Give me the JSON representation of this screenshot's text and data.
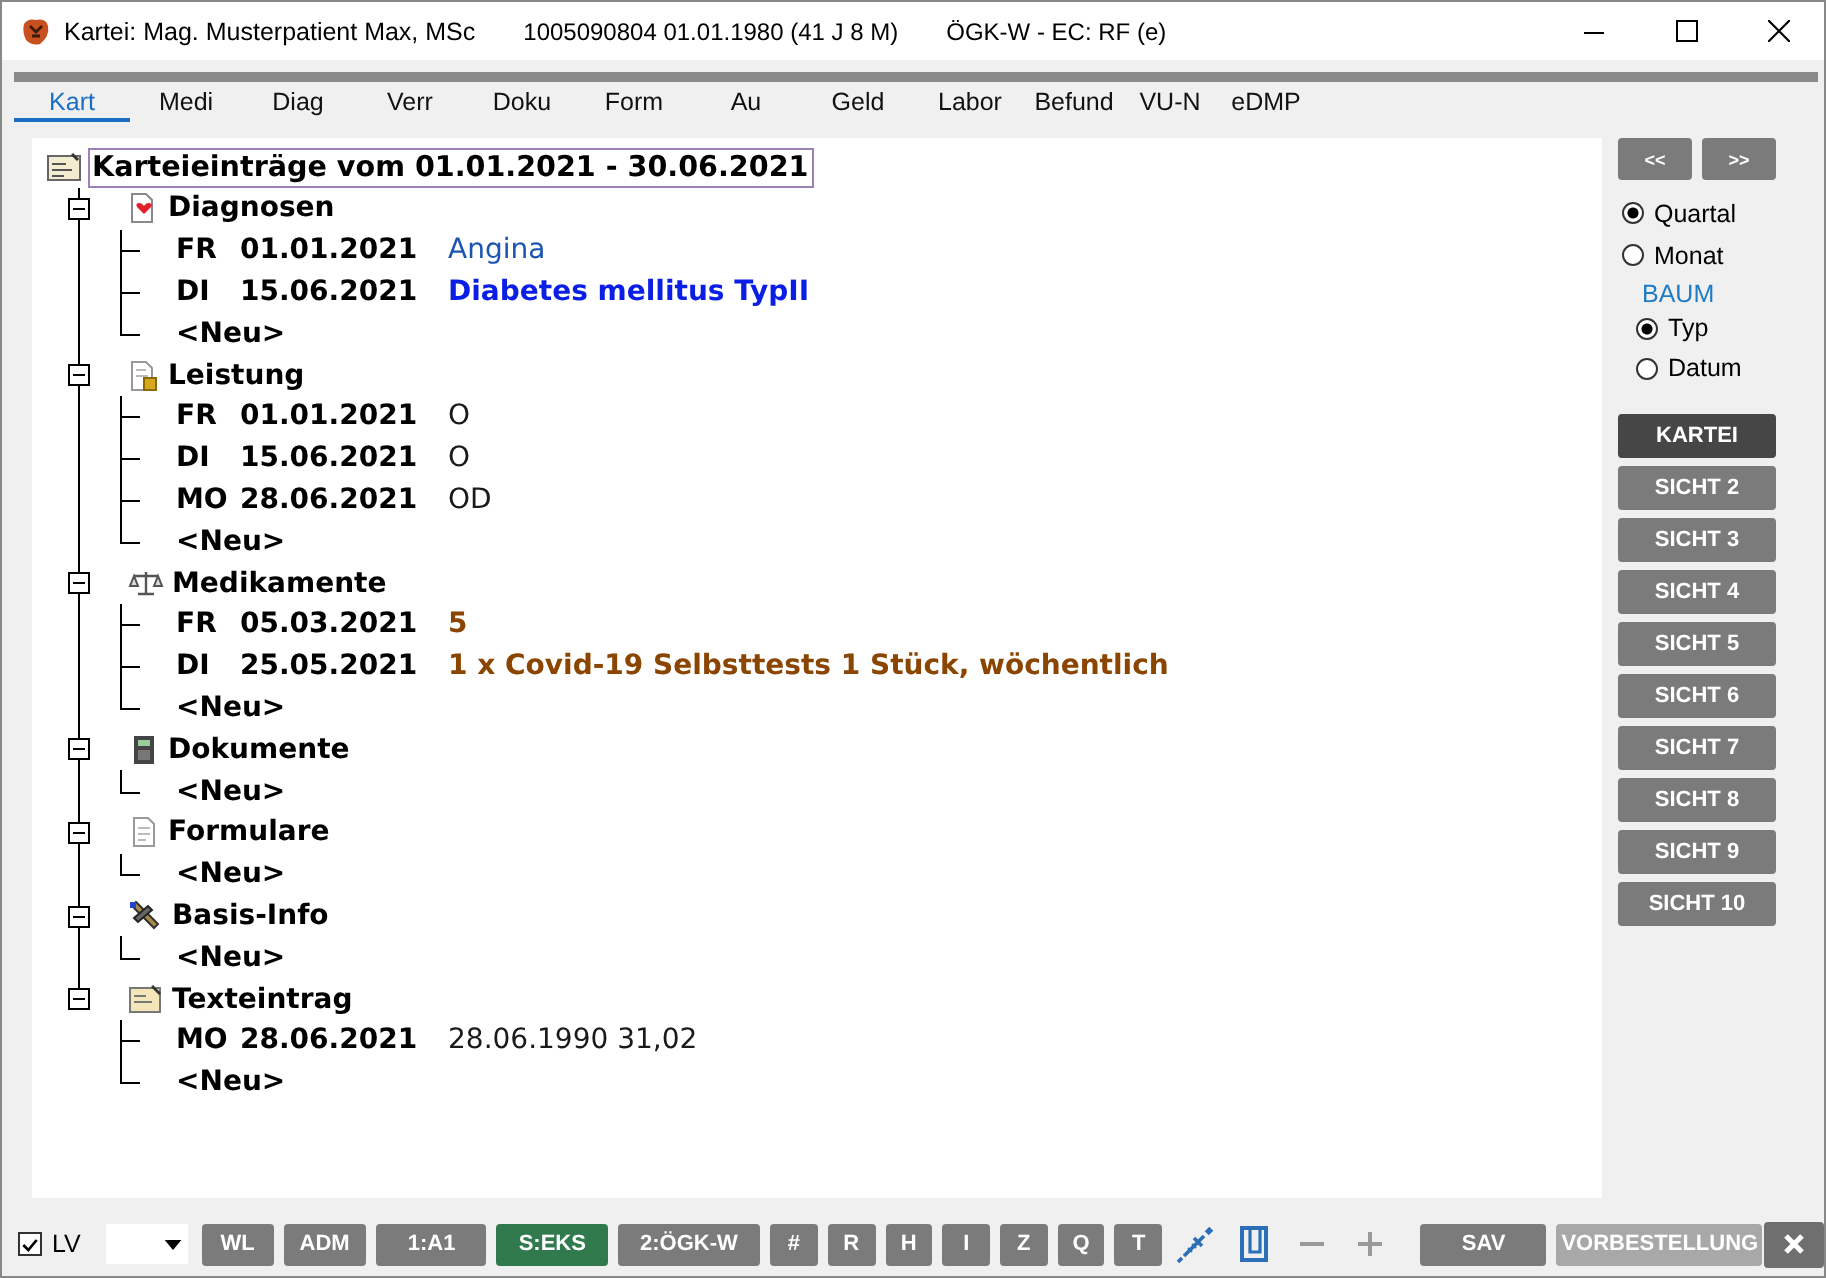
{
  "window": {
    "title": "Kartei: Mag. Musterpatient Max, MSc",
    "patient_info": "1005090804 01.01.1980 (41 J 8 M)",
    "insurance": "ÖGK-W - EC: RF (e)"
  },
  "tabs": [
    {
      "label": "Kart",
      "selected": true
    },
    {
      "label": "Medi",
      "selected": false
    },
    {
      "label": "Diag",
      "selected": false
    },
    {
      "label": "Verr",
      "selected": false
    },
    {
      "label": "Doku",
      "selected": false
    },
    {
      "label": "Form",
      "selected": false
    },
    {
      "label": "Au",
      "selected": false
    },
    {
      "label": "Geld",
      "selected": false
    },
    {
      "label": "Labor",
      "selected": false
    },
    {
      "label": "Befund",
      "selected": false
    },
    {
      "label": "VU-N",
      "selected": false
    },
    {
      "label": "eDMP",
      "selected": false
    }
  ],
  "tree": {
    "title": "Karteieinträge vom 01.01.2021 - 30.06.2021",
    "groups": [
      {
        "label": "Diagnosen",
        "expanded": true,
        "children": [
          {
            "kind": "entry",
            "day": "FR",
            "date": "01.01.2021",
            "text": "Angina",
            "color": "#1b55b0",
            "bold": false
          },
          {
            "kind": "entry",
            "day": "DI",
            "date": "15.06.2021",
            "text": "Diabetes mellitus TypII",
            "color": "#0b1ee6",
            "bold": true
          },
          {
            "kind": "new",
            "label": "<Neu>"
          }
        ]
      },
      {
        "label": "Leistung",
        "expanded": true,
        "children": [
          {
            "kind": "entry",
            "day": "FR",
            "date": "01.01.2021",
            "text": "O",
            "color": "#1a1a1a",
            "bold": false
          },
          {
            "kind": "entry",
            "day": "DI",
            "date": "15.06.2021",
            "text": "O",
            "color": "#1a1a1a",
            "bold": false
          },
          {
            "kind": "entry",
            "day": "MO",
            "date": "28.06.2021",
            "text": "OD",
            "color": "#1a1a1a",
            "bold": false
          },
          {
            "kind": "new",
            "label": "<Neu>"
          }
        ]
      },
      {
        "label": "Medikamente",
        "expanded": true,
        "children": [
          {
            "kind": "entry",
            "day": "FR",
            "date": "05.03.2021",
            "text": "5",
            "color": "#8a4500",
            "bold": true
          },
          {
            "kind": "entry",
            "day": "DI",
            "date": "25.05.2021",
            "text": "1 x Covid-19 Selbsttests 1 Stück, wöchentlich",
            "color": "#8a4500",
            "bold": true
          },
          {
            "kind": "new",
            "label": "<Neu>"
          }
        ]
      },
      {
        "label": "Dokumente",
        "expanded": true,
        "children": [
          {
            "kind": "new",
            "label": "<Neu>"
          }
        ]
      },
      {
        "label": "Formulare",
        "expanded": true,
        "children": [
          {
            "kind": "new",
            "label": "<Neu>"
          }
        ]
      },
      {
        "label": "Basis-Info",
        "expanded": true,
        "children": [
          {
            "kind": "new",
            "label": "<Neu>"
          }
        ]
      },
      {
        "label": "Texteintrag",
        "expanded": true,
        "children": [
          {
            "kind": "entry",
            "day": "MO",
            "date": "28.06.2021",
            "text": "28.06.1990 31,02",
            "color": "#1a1a1a",
            "bold": false
          },
          {
            "kind": "new",
            "label": "<Neu>"
          }
        ]
      }
    ]
  },
  "nav_buttons": [
    "<<",
    ">>"
  ],
  "period_options": [
    {
      "label": "Quartal",
      "selected": true
    },
    {
      "label": "Monat",
      "selected": false
    }
  ],
  "tree_mode": {
    "label": "BAUM",
    "options": [
      {
        "label": "Typ",
        "selected": true
      },
      {
        "label": "Datum",
        "selected": false
      }
    ]
  },
  "views": [
    {
      "label": "KARTEI",
      "selected": true
    },
    {
      "label": "SICHT 2",
      "selected": false
    },
    {
      "label": "SICHT 3",
      "selected": false
    },
    {
      "label": "SICHT 4",
      "selected": false
    },
    {
      "label": "SICHT 5",
      "selected": false
    },
    {
      "label": "SICHT 6",
      "selected": false
    },
    {
      "label": "SICHT 7",
      "selected": false
    },
    {
      "label": "SICHT 8",
      "selected": false
    },
    {
      "label": "SICHT 9",
      "selected": false
    },
    {
      "label": "SICHT 10",
      "selected": false
    }
  ],
  "lv": {
    "label": "LV",
    "checked": true
  },
  "buttons_left": [
    {
      "label": "WL",
      "active": false
    },
    {
      "label": "ADM",
      "active": false
    },
    {
      "label": "1:A1",
      "active": false
    },
    {
      "label": "S:EKS",
      "active": true
    },
    {
      "label": "2:ÖGK-W",
      "active": false
    },
    {
      "label": "#",
      "active": false
    },
    {
      "label": "R",
      "active": false
    },
    {
      "label": "H",
      "active": false
    },
    {
      "label": "I",
      "active": false
    },
    {
      "label": "Z",
      "active": false
    },
    {
      "label": "Q",
      "active": false
    },
    {
      "label": "T",
      "active": false
    }
  ],
  "buttons_right": [
    {
      "label": "SAV",
      "disabled": false
    },
    {
      "label": "VORBESTELLUNG",
      "disabled": true
    }
  ]
}
